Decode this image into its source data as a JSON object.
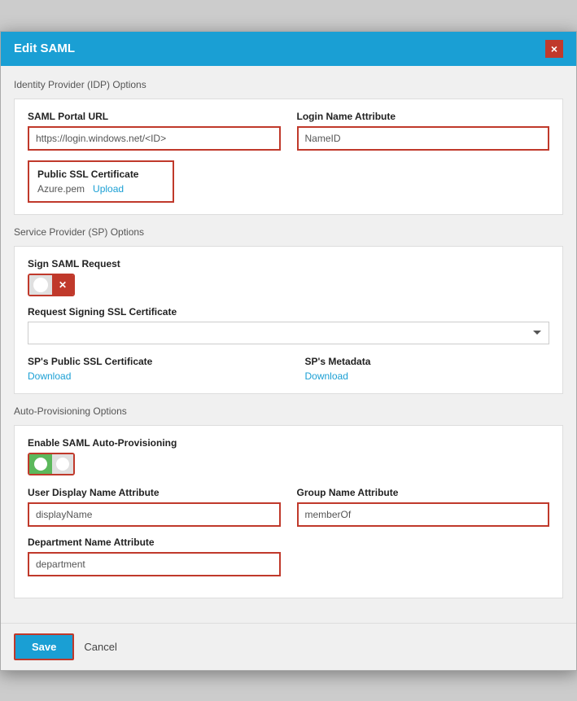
{
  "modal": {
    "title": "Edit SAML",
    "close_label": "×"
  },
  "idp_section": {
    "title": "Identity Provider (IDP) Options",
    "saml_url_label": "SAML Portal URL",
    "saml_url_value": "https://login.windows.net/<ID>",
    "login_name_label": "Login Name Attribute",
    "login_name_value": "NameID",
    "ssl_cert_label": "Public SSL Certificate",
    "ssl_cert_filename": "Azure.pem",
    "ssl_upload_label": "Upload"
  },
  "sp_section": {
    "title": "Service Provider (SP) Options",
    "sign_saml_label": "Sign SAML Request",
    "sign_saml_toggle_on": false,
    "request_signing_label": "Request Signing SSL Certificate",
    "request_signing_placeholder": "",
    "sp_public_ssl_label": "SP's Public SSL Certificate",
    "sp_public_ssl_download": "Download",
    "sp_metadata_label": "SP's Metadata",
    "sp_metadata_download": "Download"
  },
  "auto_prov_section": {
    "title": "Auto-Provisioning Options",
    "enable_label": "Enable SAML Auto-Provisioning",
    "enable_toggle_on": true,
    "user_display_label": "User Display Name Attribute",
    "user_display_value": "displayName",
    "group_name_label": "Group Name Attribute",
    "group_name_value": "memberOf",
    "dept_name_label": "Department Name Attribute",
    "dept_name_value": "department"
  },
  "footer": {
    "save_label": "Save",
    "cancel_label": "Cancel"
  }
}
